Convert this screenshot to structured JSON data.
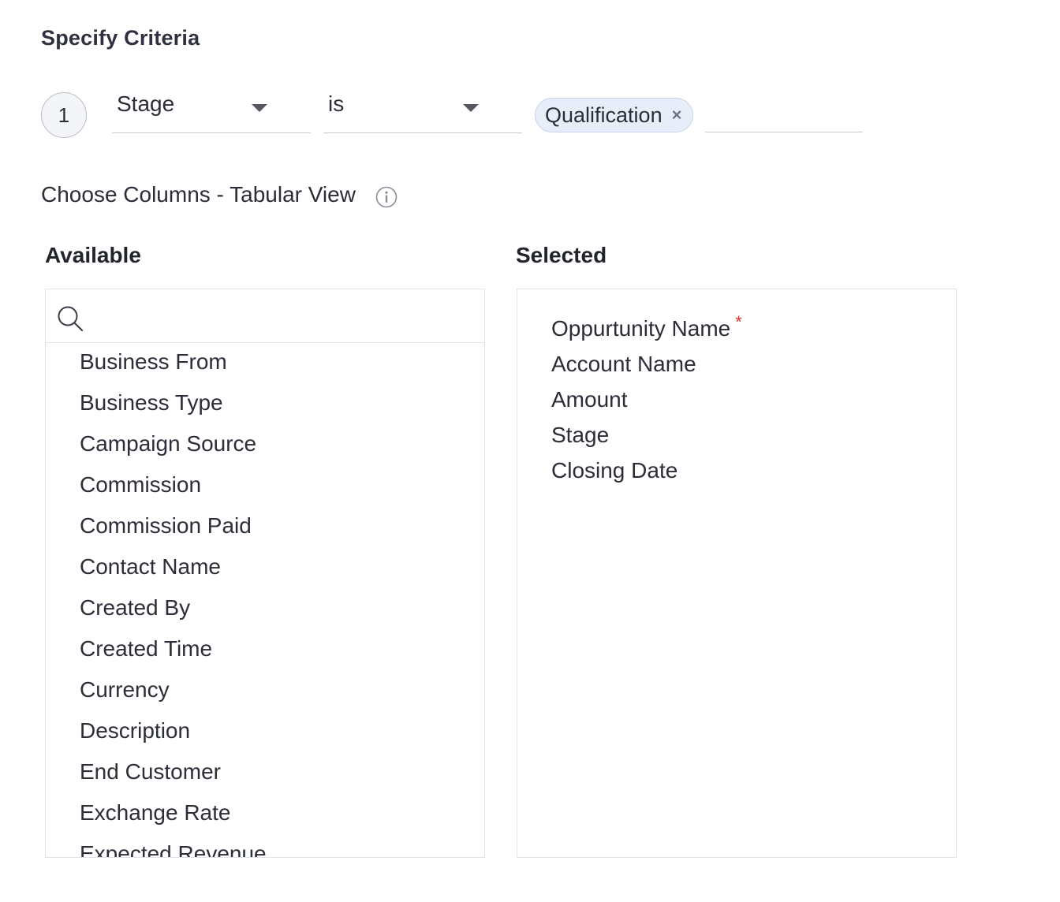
{
  "criteria": {
    "title": "Specify Criteria",
    "row_number": "1",
    "field": "Stage",
    "operator": "is",
    "values": [
      "Qualification"
    ],
    "chip_remove_symbol": "×"
  },
  "columns": {
    "title": "Choose Columns - Tabular View",
    "available_heading": "Available",
    "selected_heading": "Selected",
    "search_placeholder": "",
    "available": [
      "Business From",
      "Business Type",
      "Campaign Source",
      "Commission",
      "Commission Paid",
      "Contact Name",
      "Created By",
      "Created Time",
      "Currency",
      "Description",
      "End Customer",
      "Exchange Rate",
      "Expected Revenue"
    ],
    "selected": [
      {
        "label": "Oppurtunity Name",
        "required_mark": "*"
      },
      {
        "label": "Account Name",
        "required_mark": ""
      },
      {
        "label": "Amount",
        "required_mark": ""
      },
      {
        "label": "Stage",
        "required_mark": ""
      },
      {
        "label": "Closing Date",
        "required_mark": ""
      }
    ]
  },
  "icons": {
    "dropdown": "chevron-down-icon",
    "info": "info-icon",
    "search": "search-icon",
    "remove": "close-icon"
  },
  "colors": {
    "chip_background": "#e7eefa",
    "chip_border": "#c6d3ea",
    "required": "#e0322d",
    "text": "#2b2d37",
    "border": "#dfe2e8"
  }
}
